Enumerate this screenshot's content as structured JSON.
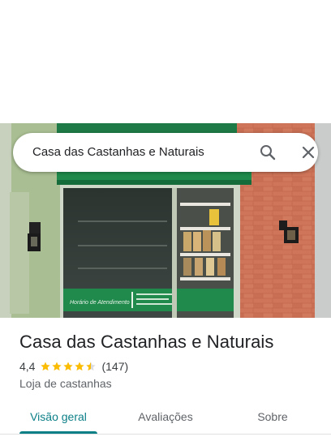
{
  "search": {
    "query": "Casa das Castanhas e Naturais"
  },
  "place": {
    "name": "Casa das Castanhas e Naturais",
    "rating": "4,4",
    "stars": 4.4,
    "review_count": "(147)",
    "category": "Loja de castanhas",
    "storefront_sign": "Horário de Atendimento"
  },
  "tabs": [
    {
      "label": "Visão geral",
      "active": true
    },
    {
      "label": "Avaliações",
      "active": false
    },
    {
      "label": "Sobre",
      "active": false
    }
  ],
  "colors": {
    "star": "#fbbc04",
    "accent": "#0b7f86",
    "awning": "#1e8a4a"
  },
  "icons": {
    "search": "search-icon",
    "close": "close-icon",
    "star": "star-icon"
  }
}
